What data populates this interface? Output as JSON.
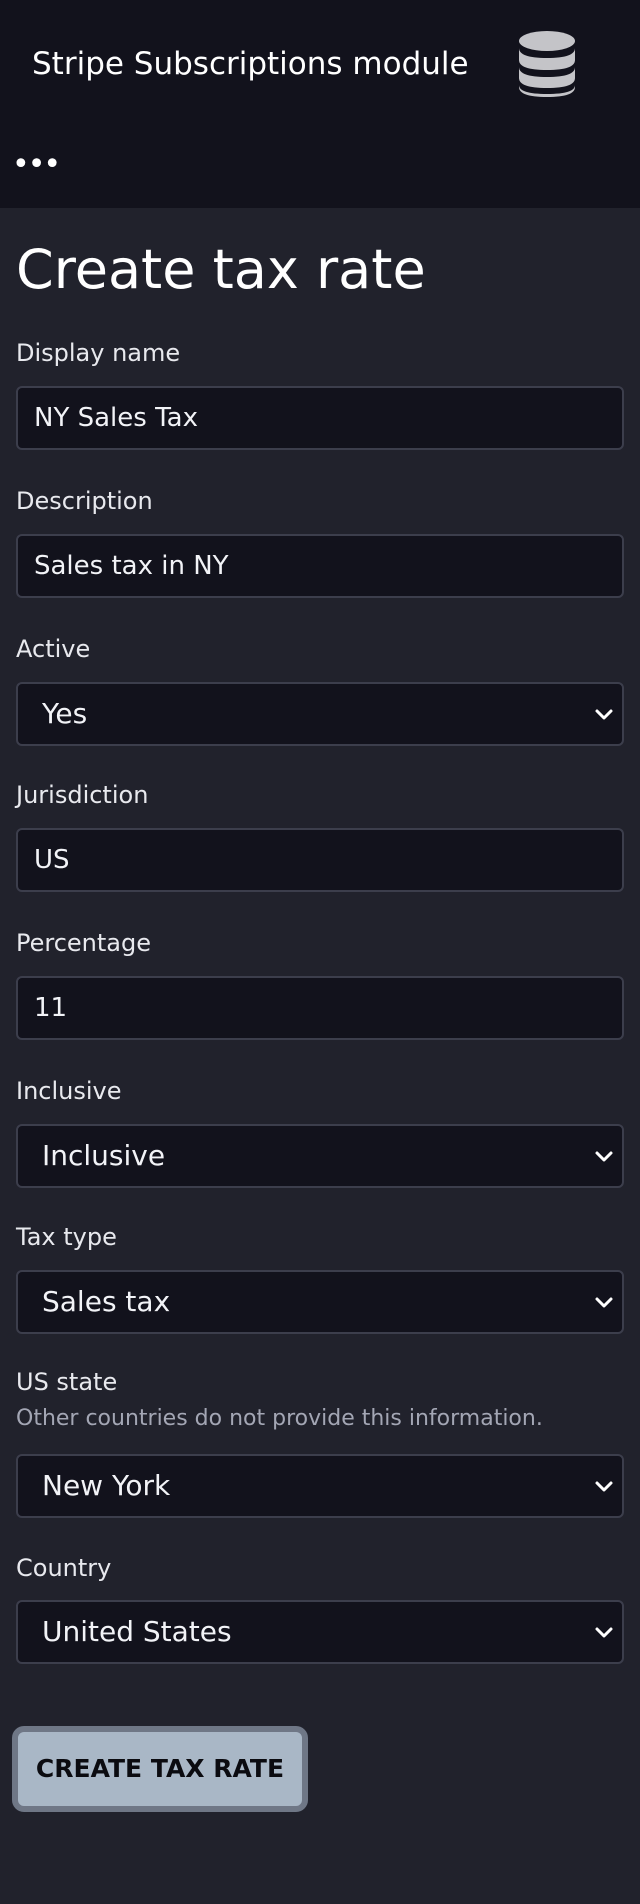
{
  "header": {
    "title": "Stripe Subscriptions module",
    "icon": "database-icon",
    "menu_label": "•••"
  },
  "page": {
    "title": "Create tax rate"
  },
  "form": {
    "display_name": {
      "label": "Display name",
      "value": "NY Sales Tax"
    },
    "description": {
      "label": "Description",
      "value": "Sales tax in NY"
    },
    "active": {
      "label": "Active",
      "value": "Yes"
    },
    "jurisdiction": {
      "label": "Jurisdiction",
      "value": "US"
    },
    "percentage": {
      "label": "Percentage",
      "value": "11"
    },
    "inclusive": {
      "label": "Inclusive",
      "value": "Inclusive"
    },
    "tax_type": {
      "label": "Tax type",
      "value": "Sales tax"
    },
    "us_state": {
      "label": "US state",
      "help": "Other countries do not provide this information.",
      "value": "New York"
    },
    "country": {
      "label": "Country",
      "value": "United States"
    },
    "submit_label": "CREATE TAX RATE"
  },
  "colors": {
    "header_bg": "#12121c",
    "page_bg": "#21222c",
    "input_bg": "#12121c",
    "button_bg": "#a9b7c6"
  }
}
